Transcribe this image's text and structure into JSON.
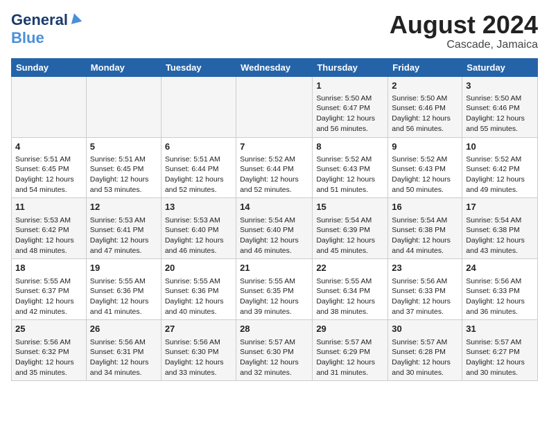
{
  "logo": {
    "general": "General",
    "blue": "Blue"
  },
  "header": {
    "title": "August 2024",
    "subtitle": "Cascade, Jamaica"
  },
  "days_of_week": [
    "Sunday",
    "Monday",
    "Tuesday",
    "Wednesday",
    "Thursday",
    "Friday",
    "Saturday"
  ],
  "weeks": [
    [
      {
        "day": "",
        "info": ""
      },
      {
        "day": "",
        "info": ""
      },
      {
        "day": "",
        "info": ""
      },
      {
        "day": "",
        "info": ""
      },
      {
        "day": "1",
        "info": "Sunrise: 5:50 AM\nSunset: 6:47 PM\nDaylight: 12 hours\nand 56 minutes."
      },
      {
        "day": "2",
        "info": "Sunrise: 5:50 AM\nSunset: 6:46 PM\nDaylight: 12 hours\nand 56 minutes."
      },
      {
        "day": "3",
        "info": "Sunrise: 5:50 AM\nSunset: 6:46 PM\nDaylight: 12 hours\nand 55 minutes."
      }
    ],
    [
      {
        "day": "4",
        "info": "Sunrise: 5:51 AM\nSunset: 6:45 PM\nDaylight: 12 hours\nand 54 minutes."
      },
      {
        "day": "5",
        "info": "Sunrise: 5:51 AM\nSunset: 6:45 PM\nDaylight: 12 hours\nand 53 minutes."
      },
      {
        "day": "6",
        "info": "Sunrise: 5:51 AM\nSunset: 6:44 PM\nDaylight: 12 hours\nand 52 minutes."
      },
      {
        "day": "7",
        "info": "Sunrise: 5:52 AM\nSunset: 6:44 PM\nDaylight: 12 hours\nand 52 minutes."
      },
      {
        "day": "8",
        "info": "Sunrise: 5:52 AM\nSunset: 6:43 PM\nDaylight: 12 hours\nand 51 minutes."
      },
      {
        "day": "9",
        "info": "Sunrise: 5:52 AM\nSunset: 6:43 PM\nDaylight: 12 hours\nand 50 minutes."
      },
      {
        "day": "10",
        "info": "Sunrise: 5:52 AM\nSunset: 6:42 PM\nDaylight: 12 hours\nand 49 minutes."
      }
    ],
    [
      {
        "day": "11",
        "info": "Sunrise: 5:53 AM\nSunset: 6:42 PM\nDaylight: 12 hours\nand 48 minutes."
      },
      {
        "day": "12",
        "info": "Sunrise: 5:53 AM\nSunset: 6:41 PM\nDaylight: 12 hours\nand 47 minutes."
      },
      {
        "day": "13",
        "info": "Sunrise: 5:53 AM\nSunset: 6:40 PM\nDaylight: 12 hours\nand 46 minutes."
      },
      {
        "day": "14",
        "info": "Sunrise: 5:54 AM\nSunset: 6:40 PM\nDaylight: 12 hours\nand 46 minutes."
      },
      {
        "day": "15",
        "info": "Sunrise: 5:54 AM\nSunset: 6:39 PM\nDaylight: 12 hours\nand 45 minutes."
      },
      {
        "day": "16",
        "info": "Sunrise: 5:54 AM\nSunset: 6:38 PM\nDaylight: 12 hours\nand 44 minutes."
      },
      {
        "day": "17",
        "info": "Sunrise: 5:54 AM\nSunset: 6:38 PM\nDaylight: 12 hours\nand 43 minutes."
      }
    ],
    [
      {
        "day": "18",
        "info": "Sunrise: 5:55 AM\nSunset: 6:37 PM\nDaylight: 12 hours\nand 42 minutes."
      },
      {
        "day": "19",
        "info": "Sunrise: 5:55 AM\nSunset: 6:36 PM\nDaylight: 12 hours\nand 41 minutes."
      },
      {
        "day": "20",
        "info": "Sunrise: 5:55 AM\nSunset: 6:36 PM\nDaylight: 12 hours\nand 40 minutes."
      },
      {
        "day": "21",
        "info": "Sunrise: 5:55 AM\nSunset: 6:35 PM\nDaylight: 12 hours\nand 39 minutes."
      },
      {
        "day": "22",
        "info": "Sunrise: 5:55 AM\nSunset: 6:34 PM\nDaylight: 12 hours\nand 38 minutes."
      },
      {
        "day": "23",
        "info": "Sunrise: 5:56 AM\nSunset: 6:33 PM\nDaylight: 12 hours\nand 37 minutes."
      },
      {
        "day": "24",
        "info": "Sunrise: 5:56 AM\nSunset: 6:33 PM\nDaylight: 12 hours\nand 36 minutes."
      }
    ],
    [
      {
        "day": "25",
        "info": "Sunrise: 5:56 AM\nSunset: 6:32 PM\nDaylight: 12 hours\nand 35 minutes."
      },
      {
        "day": "26",
        "info": "Sunrise: 5:56 AM\nSunset: 6:31 PM\nDaylight: 12 hours\nand 34 minutes."
      },
      {
        "day": "27",
        "info": "Sunrise: 5:56 AM\nSunset: 6:30 PM\nDaylight: 12 hours\nand 33 minutes."
      },
      {
        "day": "28",
        "info": "Sunrise: 5:57 AM\nSunset: 6:30 PM\nDaylight: 12 hours\nand 32 minutes."
      },
      {
        "day": "29",
        "info": "Sunrise: 5:57 AM\nSunset: 6:29 PM\nDaylight: 12 hours\nand 31 minutes."
      },
      {
        "day": "30",
        "info": "Sunrise: 5:57 AM\nSunset: 6:28 PM\nDaylight: 12 hours\nand 30 minutes."
      },
      {
        "day": "31",
        "info": "Sunrise: 5:57 AM\nSunset: 6:27 PM\nDaylight: 12 hours\nand 30 minutes."
      }
    ]
  ]
}
